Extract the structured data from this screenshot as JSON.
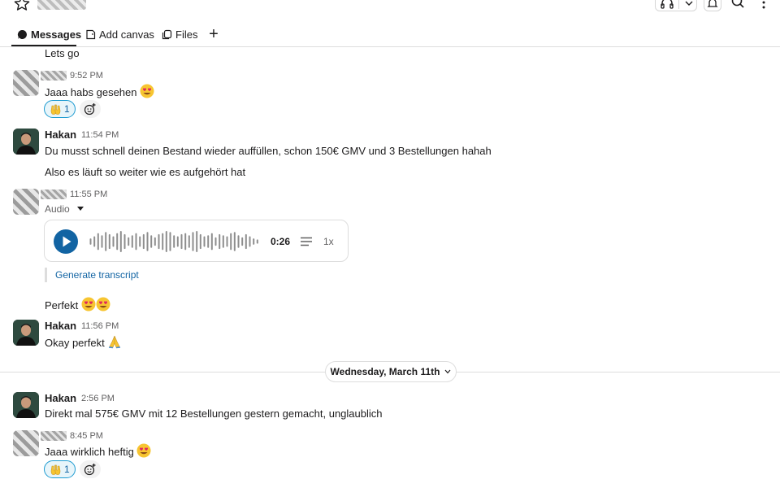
{
  "tabs": {
    "messages": "Messages",
    "add_canvas": "Add canvas",
    "files": "Files",
    "add": "+"
  },
  "messages": [
    {
      "text": "Lets go"
    },
    {
      "time": "9:52 PM",
      "text": "Jaaa habs gesehen",
      "emoji": "heart-eyes",
      "reaction": {
        "emoji": "raised-hands",
        "count": "1"
      }
    },
    {
      "name": "Hakan",
      "time": "11:54 PM",
      "text": "Du musst schnell deinen Bestand wieder auffüllen, schon 150€ GMV und 3 Bestellungen hahah"
    },
    {
      "text": "Also es läuft so weiter wie es aufgehört hat"
    },
    {
      "time": "11:55 PM",
      "audio_label": "Audio",
      "audio_duration": "0:26",
      "audio_speed": "1x",
      "transcript_link": "Generate transcript"
    },
    {
      "text": "Perfekt",
      "emoji": "heart-eyes x2"
    },
    {
      "name": "Hakan",
      "time": "11:56 PM",
      "text": "Okay perfekt",
      "emoji": "folded-hands"
    },
    {
      "name": "Hakan",
      "time": "2:56 PM",
      "text": "Direkt mal 575€ GMV mit 12 Bestellungen gestern gemacht, unglaublich"
    },
    {
      "time": "8:45 PM",
      "text": "Jaaa wirklich heftig",
      "emoji": "heart-eyes",
      "reaction": {
        "emoji": "raised-hands",
        "count": "1"
      }
    }
  ],
  "date_divider": "Wednesday, March 11th",
  "colors": {
    "accent": "#1264a3",
    "reaction_bg": "#e8f5fa",
    "reaction_border": "#1d9bd1",
    "divider": "#dddddd"
  },
  "icons": [
    "star-icon",
    "headphones-icon",
    "chevron-down-icon",
    "bell-icon",
    "search-icon",
    "more-vertical-icon",
    "message-icon",
    "canvas-icon",
    "files-icon",
    "plus-icon",
    "heart-eyes-emoji",
    "raised-hands-emoji",
    "add-reaction-icon",
    "play-icon",
    "transcript-lines-icon",
    "folded-hands-emoji"
  ]
}
